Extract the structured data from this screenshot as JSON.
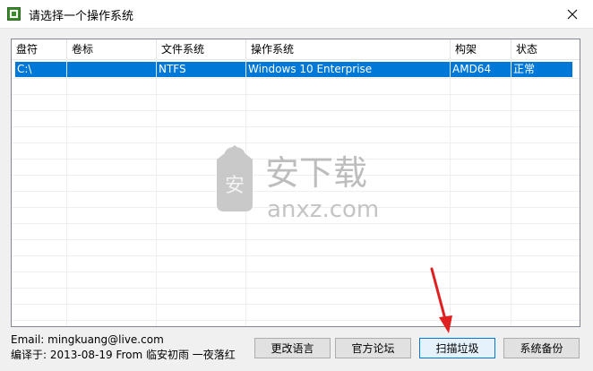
{
  "window": {
    "title": "请选择一个操作系统"
  },
  "table": {
    "columns": [
      "盘符",
      "卷标",
      "文件系统",
      "操作系统",
      "构架",
      "状态"
    ],
    "rows": [
      {
        "drive": "C:\\",
        "label": "",
        "fs": "NTFS",
        "os": "Windows 10 Enterprise",
        "arch": "AMD64",
        "status": "正常",
        "selected": true
      }
    ]
  },
  "info": {
    "email": "Email:  mingkuang@live.com",
    "compiled": "编译于: 2013-08-19 From 临安初雨 一夜落红"
  },
  "buttons": {
    "change_language": "更改语言",
    "forum": "官方论坛",
    "scan": "扫描垃圾",
    "backup": "系统备份"
  },
  "watermark": {
    "text_cn": "安下载",
    "text_en": "anxz.com"
  },
  "colors": {
    "selection": "#0078d7",
    "accent_arrow": "#e02020"
  }
}
